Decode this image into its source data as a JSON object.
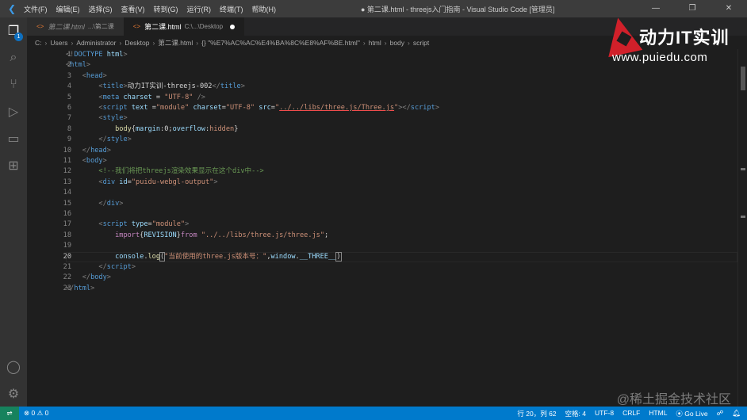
{
  "titlebar": {
    "menu": [
      "文件(F)",
      "编辑(E)",
      "选择(S)",
      "查看(V)",
      "转到(G)",
      "运行(R)",
      "终端(T)",
      "帮助(H)"
    ],
    "title": "● 第二课.html - threejs入门指南 - Visual Studio Code [管理员]",
    "controls": [
      "—",
      "❐",
      "✕"
    ]
  },
  "activity": {
    "explorer_badge": "1"
  },
  "tabs": [
    {
      "name": "第二课.html",
      "desc": "...\\第二课",
      "preview": true,
      "active": false
    },
    {
      "name": "第二课.html",
      "desc": "C:\\...\\Desktop",
      "active": true,
      "dirty": true
    }
  ],
  "breadcrumbs": [
    "C:",
    "Users",
    "Administrator",
    "Desktop",
    "第二课.html",
    "{} \"%E7%AC%AC%E4%BA%8C%E8%AF%BE.html\"",
    "html",
    "body",
    "script"
  ],
  "editor": {
    "current_line": 20,
    "lines": [
      [
        [
          "<!",
          "t-p"
        ],
        [
          "DOCTYPE",
          "t-tag"
        ],
        [
          " html",
          "t-attr"
        ],
        [
          ">",
          "t-p"
        ]
      ],
      [
        [
          "<",
          "t-p"
        ],
        [
          "html",
          "t-tag"
        ],
        [
          ">",
          "t-p"
        ]
      ],
      [
        [
          "    ",
          ""
        ],
        [
          "<",
          "t-p"
        ],
        [
          "head",
          "t-tag"
        ],
        [
          ">",
          "t-p"
        ]
      ],
      [
        [
          "        ",
          ""
        ],
        [
          "<",
          "t-p"
        ],
        [
          "title",
          "t-tag"
        ],
        [
          ">",
          "t-p"
        ],
        [
          "动力IT实训-threejs-002",
          "t-txt"
        ],
        [
          "</",
          "t-p"
        ],
        [
          "title",
          "t-tag"
        ],
        [
          ">",
          "t-p"
        ]
      ],
      [
        [
          "        ",
          ""
        ],
        [
          "<",
          "t-p"
        ],
        [
          "meta",
          "t-tag"
        ],
        [
          " charset",
          "t-attr"
        ],
        [
          " = ",
          "t-txt"
        ],
        [
          "\"UTF-8\"",
          "t-str"
        ],
        [
          " />",
          "t-p"
        ]
      ],
      [
        [
          "        ",
          ""
        ],
        [
          "<",
          "t-p"
        ],
        [
          "script",
          "t-tag"
        ],
        [
          " text",
          "t-attr"
        ],
        [
          " =",
          "t-txt"
        ],
        [
          "\"module\"",
          "t-str"
        ],
        [
          " charset",
          "t-attr"
        ],
        [
          "=",
          "t-txt"
        ],
        [
          "\"UTF-8\"",
          "t-str"
        ],
        [
          " src",
          "t-attr"
        ],
        [
          "=",
          "t-txt"
        ],
        [
          "\"",
          "t-str"
        ],
        [
          "../../libs/three.js/Three.js",
          "t-link"
        ],
        [
          "\"",
          "t-str"
        ],
        [
          "></",
          "t-p"
        ],
        [
          "script",
          "t-tag"
        ],
        [
          ">",
          "t-p"
        ]
      ],
      [
        [
          "        ",
          ""
        ],
        [
          "<",
          "t-p"
        ],
        [
          "style",
          "t-tag"
        ],
        [
          ">",
          "t-p"
        ]
      ],
      [
        [
          "            ",
          ""
        ],
        [
          "body",
          "t-fn"
        ],
        [
          "{",
          "t-txt"
        ],
        [
          "margin",
          "t-var"
        ],
        [
          ":0;",
          "t-txt"
        ],
        [
          "overflow",
          "t-var"
        ],
        [
          ":",
          "t-txt"
        ],
        [
          "hidden",
          "t-str"
        ],
        [
          "}",
          "t-txt"
        ]
      ],
      [
        [
          "        ",
          ""
        ],
        [
          "</",
          "t-p"
        ],
        [
          "style",
          "t-tag"
        ],
        [
          ">",
          "t-p"
        ]
      ],
      [
        [
          "    ",
          ""
        ],
        [
          "</",
          "t-p"
        ],
        [
          "head",
          "t-tag"
        ],
        [
          ">",
          "t-p"
        ]
      ],
      [
        [
          "    ",
          ""
        ],
        [
          "<",
          "t-p"
        ],
        [
          "body",
          "t-tag"
        ],
        [
          ">",
          "t-p"
        ]
      ],
      [
        [
          "        ",
          ""
        ],
        [
          "<!--我们将把threejs渲染效果显示在这个div中-->",
          "t-cmt"
        ]
      ],
      [
        [
          "        ",
          ""
        ],
        [
          "<",
          "t-p"
        ],
        [
          "div",
          "t-tag"
        ],
        [
          " id",
          "t-attr"
        ],
        [
          "=",
          "t-txt"
        ],
        [
          "\"puidu-webgl-output\"",
          "t-str"
        ],
        [
          ">",
          "t-p"
        ]
      ],
      [],
      [
        [
          "        ",
          ""
        ],
        [
          "</",
          "t-p"
        ],
        [
          "div",
          "t-tag"
        ],
        [
          ">",
          "t-p"
        ]
      ],
      [],
      [
        [
          "        ",
          ""
        ],
        [
          "<",
          "t-p"
        ],
        [
          "script",
          "t-tag"
        ],
        [
          " type",
          "t-attr"
        ],
        [
          "=",
          "t-txt"
        ],
        [
          "\"module\"",
          "t-str"
        ],
        [
          ">",
          "t-p"
        ]
      ],
      [
        [
          "            ",
          ""
        ],
        [
          "import",
          "t-kw"
        ],
        [
          "{",
          "t-txt"
        ],
        [
          "REVISION",
          "t-var"
        ],
        [
          "}",
          "t-txt"
        ],
        [
          "from",
          "t-kw"
        ],
        [
          " ",
          "t-txt"
        ],
        [
          "\"../../libs/three.js/three.js\"",
          "t-str"
        ],
        [
          ";",
          "t-txt"
        ]
      ],
      [],
      [
        [
          "            ",
          ""
        ],
        [
          "console",
          "t-var"
        ],
        [
          ".",
          "t-txt"
        ],
        [
          "log",
          "t-fn"
        ],
        [
          "(",
          "t-br"
        ],
        [
          "\"当前使用的three.js版本号：\"",
          "t-str"
        ],
        [
          ",",
          "t-txt"
        ],
        [
          "window",
          "t-var"
        ],
        [
          ".",
          "t-txt"
        ],
        [
          "__THREE__",
          "t-var"
        ],
        [
          ")",
          "t-br"
        ]
      ],
      [
        [
          "        ",
          ""
        ],
        [
          "</",
          "t-p"
        ],
        [
          "script",
          "t-tag"
        ],
        [
          ">",
          "t-p"
        ]
      ],
      [
        [
          "    ",
          ""
        ],
        [
          "</",
          "t-p"
        ],
        [
          "body",
          "t-tag"
        ],
        [
          ">",
          "t-p"
        ]
      ],
      [
        [
          "</",
          "t-p"
        ],
        [
          "html",
          "t-tag"
        ],
        [
          ">",
          "t-p"
        ]
      ]
    ]
  },
  "status": {
    "errors": "0",
    "warnings": "0",
    "position": "行 20，列 62",
    "spaces": "空格: 4",
    "encoding": "UTF-8",
    "eol": "CRLF",
    "language": "HTML",
    "golive": "Go Live"
  },
  "brand": {
    "name": "动力IT实训",
    "url": "www.puiedu.com"
  },
  "watermark": "@稀土掘金技术社区",
  "colors": {
    "statusbar": "#007acc",
    "brand_red": "#d0202a"
  }
}
